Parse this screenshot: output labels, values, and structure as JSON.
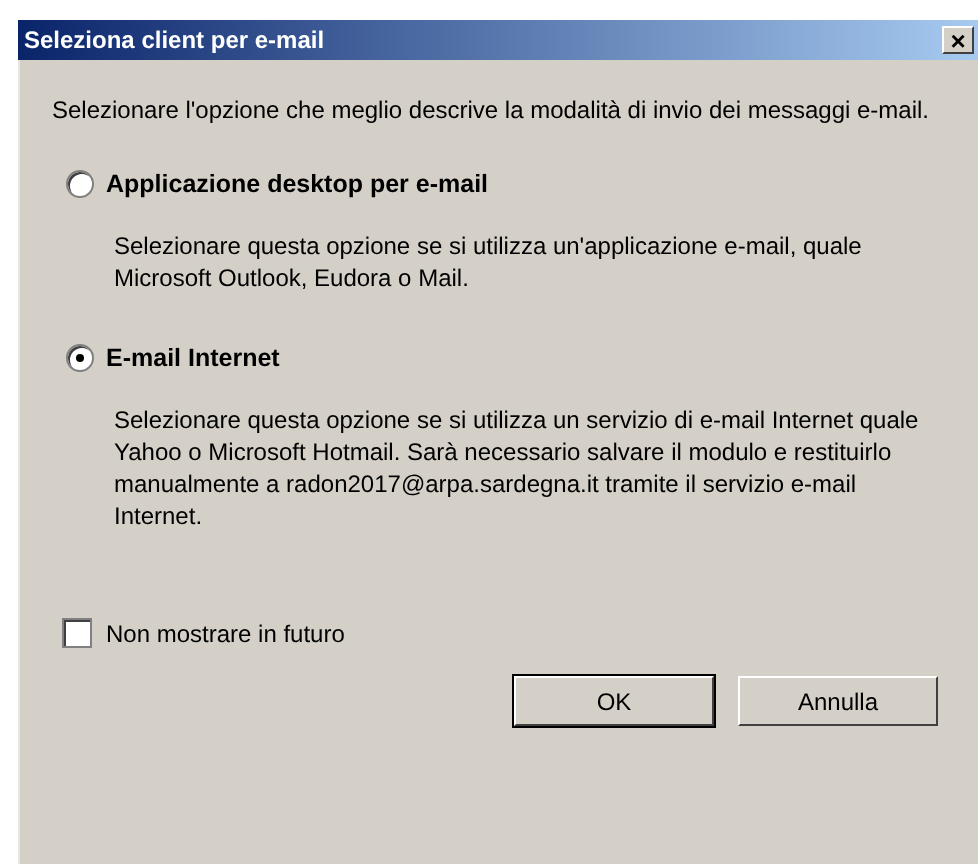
{
  "window": {
    "title": "Seleziona client per e-mail",
    "close": "×"
  },
  "intro": "Selezionare l'opzione che meglio descrive la modalità di invio dei messaggi e-mail.",
  "options": [
    {
      "label": "Applicazione desktop per e-mail",
      "selected": false,
      "description": "Selezionare questa opzione se si utilizza un'applicazione e-mail, quale Microsoft Outlook, Eudora o Mail."
    },
    {
      "label": "E-mail Internet",
      "selected": true,
      "description": "Selezionare questa opzione se si utilizza un servizio di e-mail Internet quale Yahoo o Microsoft Hotmail. Sarà necessario salvare il modulo e restituirlo manualmente a radon2017@arpa.sardegna.it tramite il servizio e-mail Internet."
    }
  ],
  "dont_show": {
    "label": "Non mostrare in futuro",
    "checked": false
  },
  "buttons": [
    "OK",
    "Annulla"
  ]
}
